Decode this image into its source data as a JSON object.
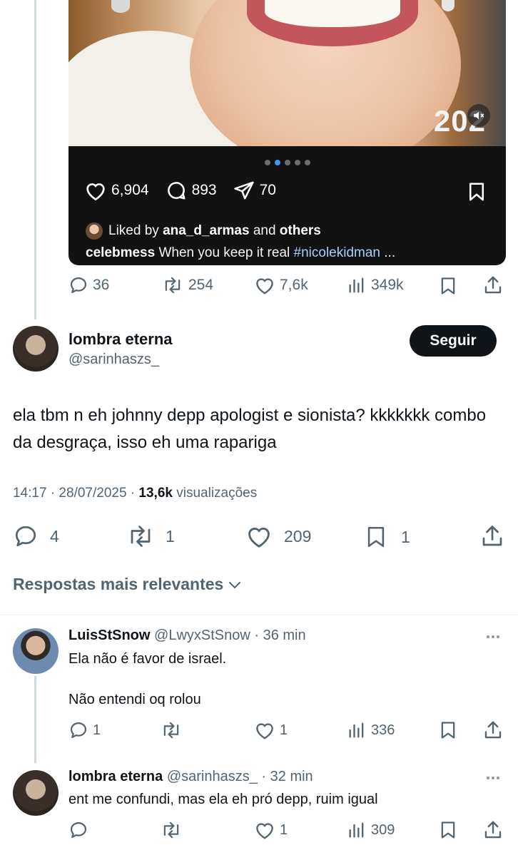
{
  "embed": {
    "photo_year": "202",
    "likes": "6,904",
    "comments": "893",
    "shares": "70",
    "liked_by_prefix": "Liked by",
    "liked_by_user": "ana_d_armas",
    "liked_by_and": "and",
    "liked_by_others": "others",
    "caption_user": "celebmess",
    "caption_text": "When you keep it real",
    "caption_tag": "#nicolekidman",
    "caption_more": "...",
    "carousel_count": 5,
    "carousel_active": 2
  },
  "quoted_stats": {
    "replies": "36",
    "reposts": "254",
    "likes": "7,6k",
    "views": "349k"
  },
  "main_tweet": {
    "name": "lombra eterna",
    "handle": "@sarinhaszs_",
    "follow_label": "Seguir",
    "text": "ela tbm n eh johnny depp apologist e sionista? kkkkkkk combo da desgraça, isso eh uma rapariga",
    "time": "14:17 · 28/07/2025 ·",
    "views_count": "13,6k",
    "views_label": "visualizações",
    "replies": "4",
    "reposts": "1",
    "likes": "209",
    "bookmarks": "1"
  },
  "sort_label": "Respostas mais relevantes",
  "replies": [
    {
      "name": "LuisStSnow",
      "handle": "@LwyxStSnow",
      "time": "· 36 min",
      "line1": "Ela não é favor de israel.",
      "line2": "Não entendi oq rolou",
      "replies": "1",
      "reposts": "",
      "likes": "1",
      "views": "336"
    },
    {
      "name": "lombra eterna",
      "handle": "@sarinhaszs_",
      "time": "· 32 min",
      "line1": "ent me confundi, mas ela eh pró depp, ruim igual",
      "replies": "",
      "reposts": "",
      "likes": "1",
      "views": "309"
    }
  ],
  "colors": {
    "accent_text": "#0f1419",
    "muted": "#536471",
    "thread_line": "#cfd9de",
    "ig_tag": "#a8cdfa",
    "ig_dot_active": "#3897f0"
  }
}
